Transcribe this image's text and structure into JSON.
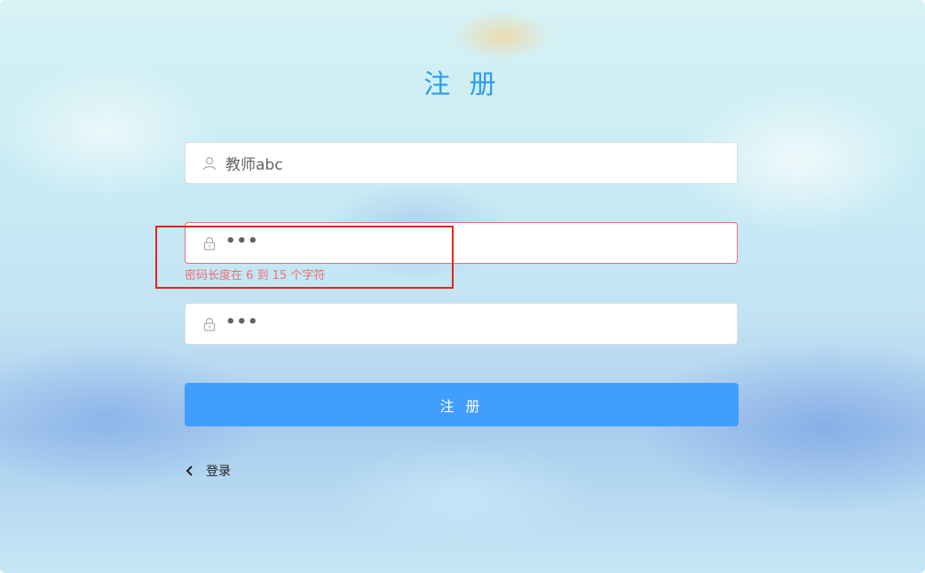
{
  "page": {
    "title": "注 册"
  },
  "form": {
    "username": {
      "value": "教师abc",
      "icon": "user-icon"
    },
    "password": {
      "masked_value": "•••",
      "icon": "lock-icon",
      "error": "密码长度在 6 到 15 个字符"
    },
    "confirm_password": {
      "masked_value": "•••",
      "icon": "lock-icon"
    },
    "submit_label": "注 册"
  },
  "footer": {
    "login_link": "登录",
    "icon": "chevron-left-icon"
  },
  "colors": {
    "primary": "#409eff",
    "title": "#2d9bef",
    "error": "#f56c6c",
    "highlight": "#e0241c"
  }
}
